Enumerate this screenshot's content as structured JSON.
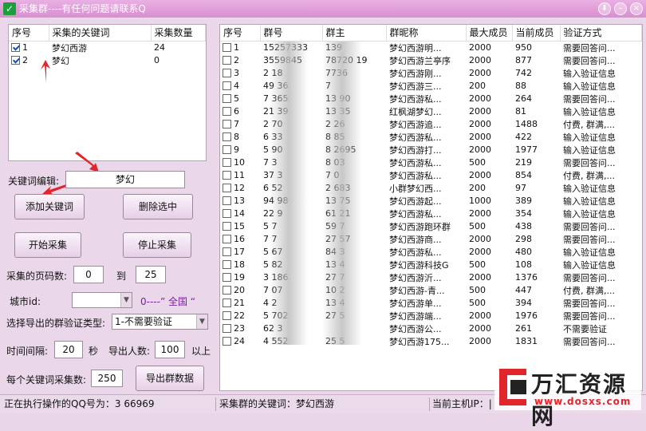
{
  "window": {
    "title": "采集群----有任何问题请联系Q",
    "app_icon_glyph": "✓"
  },
  "keywords": {
    "headers": [
      "序号",
      "采集的关键词",
      "采集数量"
    ],
    "rows": [
      {
        "seq": "1",
        "keyword": "梦幻西游",
        "count": "24",
        "checked": true
      },
      {
        "seq": "2",
        "keyword": "梦幻",
        "count": "0",
        "checked": true
      }
    ]
  },
  "controls": {
    "keyword_edit_label": "关键词编辑:",
    "keyword_edit_value": "梦幻",
    "add_keyword": "添加关键词",
    "delete_selected": "删除选中",
    "start_collect": "开始采集",
    "stop_collect": "停止采集",
    "page_label": "采集的页码数:",
    "page_from": "0",
    "page_to_label": "到",
    "page_to": "25",
    "city_label": "城市id:",
    "city_hint": "0----” 全国 “",
    "verify_label": "选择导出的群验证类型:",
    "verify_value": "1-不需要验证",
    "interval_label": "时间间隔:",
    "interval_value": "20",
    "interval_unit": "秒",
    "export_count_label": "导出人数:",
    "export_count_value": "100",
    "export_count_suffix": "以上",
    "per_keyword_label": "每个关键词采集数:",
    "per_keyword_value": "250",
    "export_button": "导出群数据"
  },
  "groups": {
    "headers": [
      "序号",
      "群号",
      "群主",
      "群昵称",
      "最大成员",
      "当前成员",
      "验证方式"
    ],
    "rows": [
      {
        "seq": "1",
        "id": "15257333",
        "owner": "139",
        "name": "梦幻西游明...",
        "max": "2000",
        "cur": "950",
        "verify": "需要回答问..."
      },
      {
        "seq": "2",
        "id": "3559845",
        "owner": "78720 19",
        "name": "梦幻西游兰亭序",
        "max": "2000",
        "cur": "877",
        "verify": "需要回答问..."
      },
      {
        "seq": "3",
        "id": "2 18",
        "owner": "7736",
        "name": "梦幻西游刚...",
        "max": "2000",
        "cur": "742",
        "verify": "输入验证信息"
      },
      {
        "seq": "4",
        "id": "49 36",
        "owner": "7",
        "name": "梦幻西游三...",
        "max": "200",
        "cur": "88",
        "verify": "输入验证信息"
      },
      {
        "seq": "5",
        "id": "7 365",
        "owner": "13 90",
        "name": "梦幻西游私...",
        "max": "2000",
        "cur": "264",
        "verify": "需要回答问..."
      },
      {
        "seq": "6",
        "id": "21 39",
        "owner": "13 35",
        "name": "红枫湖梦幻...",
        "max": "2000",
        "cur": "81",
        "verify": "输入验证信息"
      },
      {
        "seq": "7",
        "id": "2 70",
        "owner": "2 26",
        "name": "梦幻西游追...",
        "max": "2000",
        "cur": "1488",
        "verify": "付费, 群满,..."
      },
      {
        "seq": "8",
        "id": "6 33",
        "owner": "8 85",
        "name": "梦幻西游私...",
        "max": "2000",
        "cur": "422",
        "verify": "输入验证信息"
      },
      {
        "seq": "9",
        "id": "5 90",
        "owner": "8 2695",
        "name": "梦幻西游打...",
        "max": "2000",
        "cur": "1977",
        "verify": "输入验证信息"
      },
      {
        "seq": "10",
        "id": "7 3",
        "owner": "8 03",
        "name": "梦幻西游私...",
        "max": "500",
        "cur": "219",
        "verify": "需要回答问..."
      },
      {
        "seq": "11",
        "id": "37 3",
        "owner": "7 0",
        "name": "梦幻西游私...",
        "max": "2000",
        "cur": "854",
        "verify": "付费, 群满,..."
      },
      {
        "seq": "12",
        "id": "6 52",
        "owner": "2 683",
        "name": "小群梦幻西...",
        "max": "200",
        "cur": "97",
        "verify": "输入验证信息"
      },
      {
        "seq": "13",
        "id": "94 98",
        "owner": "13 75",
        "name": "梦幻西游起...",
        "max": "1000",
        "cur": "389",
        "verify": "输入验证信息"
      },
      {
        "seq": "14",
        "id": "22 9",
        "owner": "61 21",
        "name": "梦幻西游私...",
        "max": "2000",
        "cur": "354",
        "verify": "输入验证信息"
      },
      {
        "seq": "15",
        "id": "5 7",
        "owner": "59 7",
        "name": "梦幻西游跑环群",
        "max": "500",
        "cur": "438",
        "verify": "需要回答问..."
      },
      {
        "seq": "16",
        "id": "7 7",
        "owner": "27 57",
        "name": "梦幻西游商...",
        "max": "2000",
        "cur": "298",
        "verify": "需要回答问..."
      },
      {
        "seq": "17",
        "id": "5 67",
        "owner": "84 3",
        "name": "梦幻西游私...",
        "max": "2000",
        "cur": "480",
        "verify": "输入验证信息"
      },
      {
        "seq": "18",
        "id": "5 82",
        "owner": "13 4",
        "name": "梦幻西游科技G",
        "max": "500",
        "cur": "108",
        "verify": "输入验证信息"
      },
      {
        "seq": "19",
        "id": "3 186",
        "owner": "27 7",
        "name": "梦幻西游沂...",
        "max": "2000",
        "cur": "1376",
        "verify": "需要回答问..."
      },
      {
        "seq": "20",
        "id": "7 07",
        "owner": "10 2",
        "name": "梦幻西游-青...",
        "max": "500",
        "cur": "447",
        "verify": "付费, 群满,..."
      },
      {
        "seq": "21",
        "id": "4 2",
        "owner": "13 4",
        "name": "梦幻西游单...",
        "max": "500",
        "cur": "394",
        "verify": "需要回答问..."
      },
      {
        "seq": "22",
        "id": "5 702",
        "owner": "27 5",
        "name": "梦幻西游端...",
        "max": "2000",
        "cur": "1976",
        "verify": "需要回答问..."
      },
      {
        "seq": "23",
        "id": "62 3",
        "owner": "",
        "name": "梦幻西游公...",
        "max": "2000",
        "cur": "261",
        "verify": "不需要验证"
      },
      {
        "seq": "24",
        "id": "4 552",
        "owner": "25 5",
        "name": "梦幻西游175...",
        "max": "2000",
        "cur": "1831",
        "verify": "需要回答问..."
      }
    ]
  },
  "status": {
    "executing": "正在执行操作的QQ号为：3 66969",
    "keyword": "采集群的关键词：梦幻西游",
    "host_ip": "当前主机IP：|"
  },
  "watermark": {
    "text": "万汇资源网",
    "url": "www.dosxs.com"
  },
  "colors": {
    "window_bg": "#ead8ea",
    "title_bar": "#d98fd0",
    "accent_arrow": "#e0262a",
    "city_hint": "#7a1fa0"
  }
}
